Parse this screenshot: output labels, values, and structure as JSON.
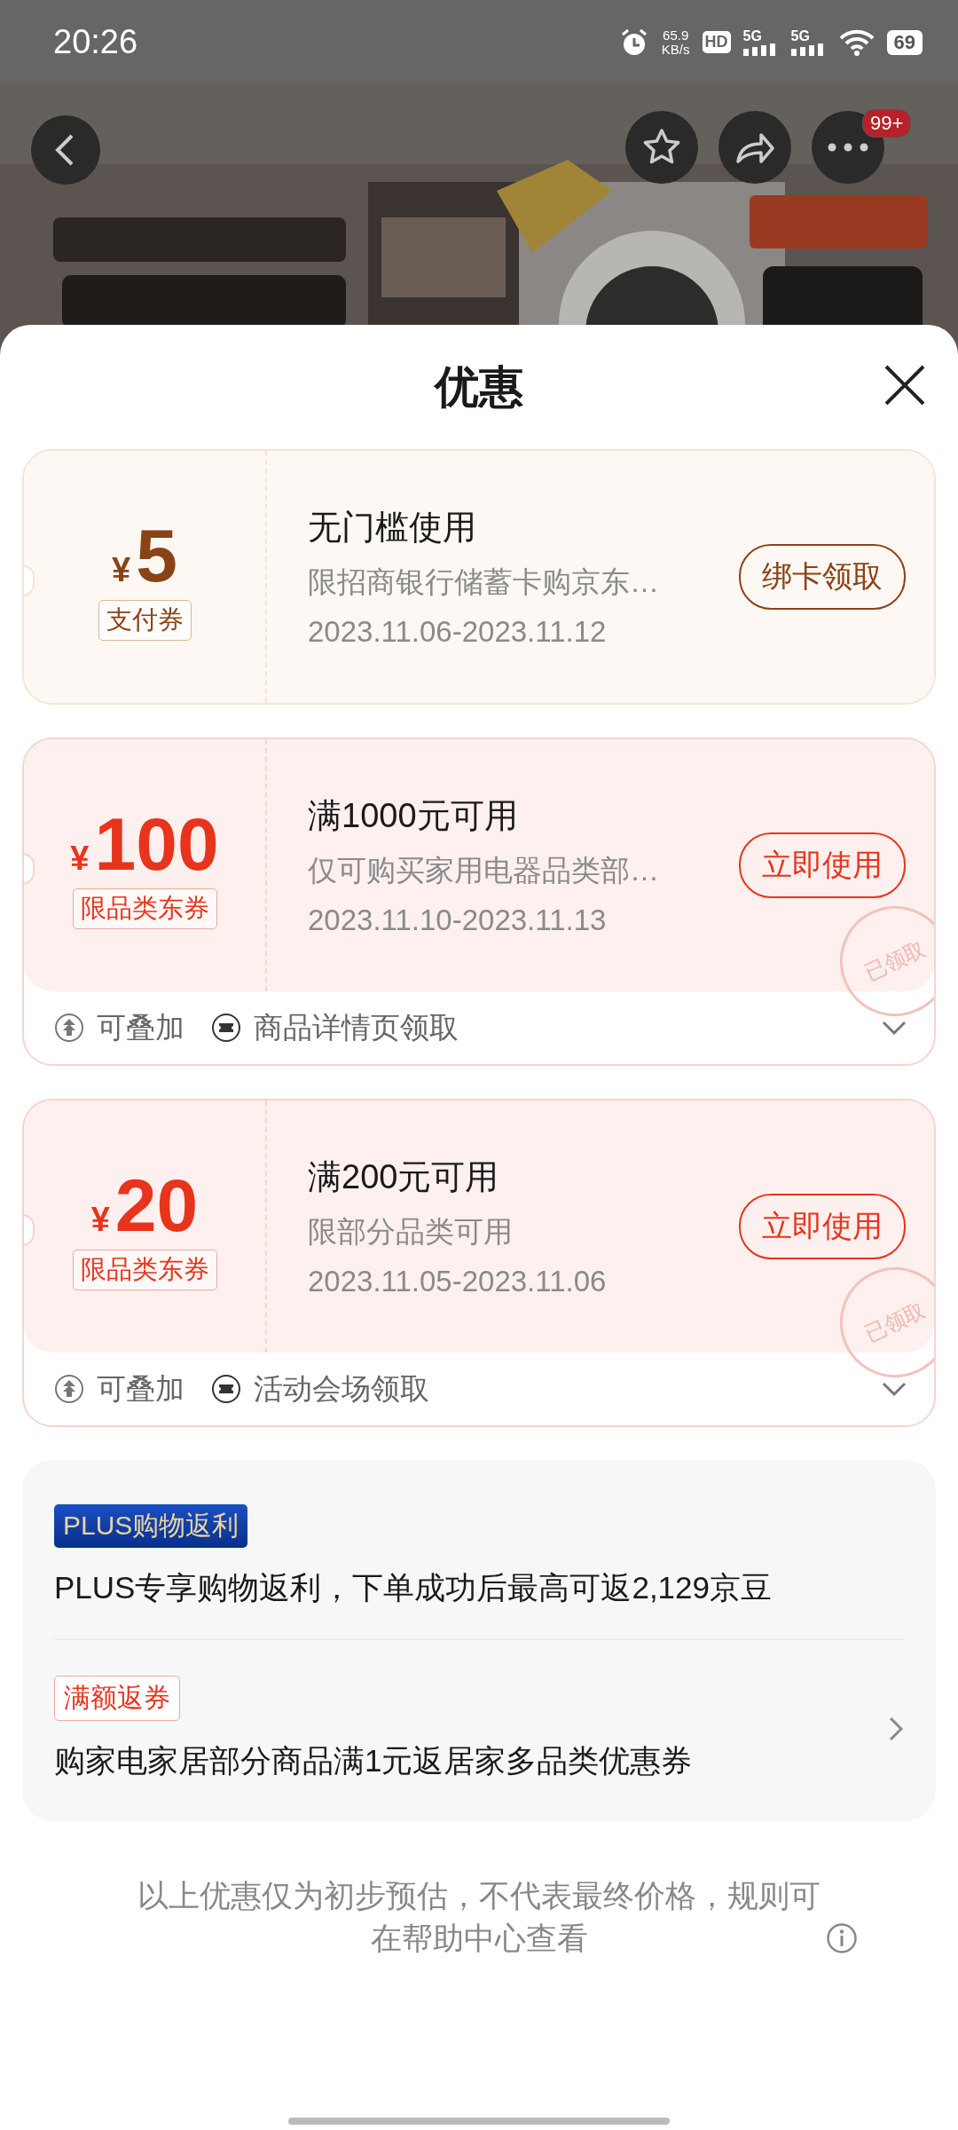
{
  "status_bar": {
    "time": "20:26",
    "net_speed": "65.9",
    "net_unit": "KB/s",
    "hd": "HD",
    "sims": [
      "5G",
      "5G"
    ],
    "battery": "69"
  },
  "top_bar": {
    "badge": "99+"
  },
  "sheet": {
    "title": "优惠"
  },
  "coupons": [
    {
      "kind": "payment",
      "currency": "¥",
      "amount": "5",
      "type_tag": "支付券",
      "title": "无门槛使用",
      "desc": "限招商银行储蓄卡购京东…",
      "validity": "2023.11.06-2023.11.12",
      "button": "绑卡领取"
    },
    {
      "kind": "category",
      "currency": "¥",
      "amount": "100",
      "type_tag": "限品类东券",
      "title": "满1000元可用",
      "desc": "仅可购买家用电器品类部…",
      "validity": "2023.11.10-2023.11.13",
      "button": "立即使用",
      "stamp": "已领取",
      "footer": {
        "stack": "可叠加",
        "source": "商品详情页领取",
        "expanded": false
      }
    },
    {
      "kind": "category",
      "currency": "¥",
      "amount": "20",
      "type_tag": "限品类东券",
      "title": "满200元可用",
      "desc": "限部分品类可用",
      "validity": "2023.11.05-2023.11.06",
      "button": "立即使用",
      "stamp": "已领取",
      "footer": {
        "stack": "可叠加",
        "source": "活动会场领取",
        "expanded": false
      }
    }
  ],
  "rebates": [
    {
      "kind": "plus",
      "tag": "PLUS购物返利",
      "text": "PLUS专享购物返利，下单成功后最高可返2,129京豆",
      "navigable": false
    },
    {
      "kind": "threshold",
      "tag": "满额返券",
      "text": "购家电家居部分商品满1元返居家多品类优惠券",
      "navigable": true
    }
  ],
  "note": "以上优惠仅为初步预估，不代表最终价格，规则可在帮助中心查看"
}
